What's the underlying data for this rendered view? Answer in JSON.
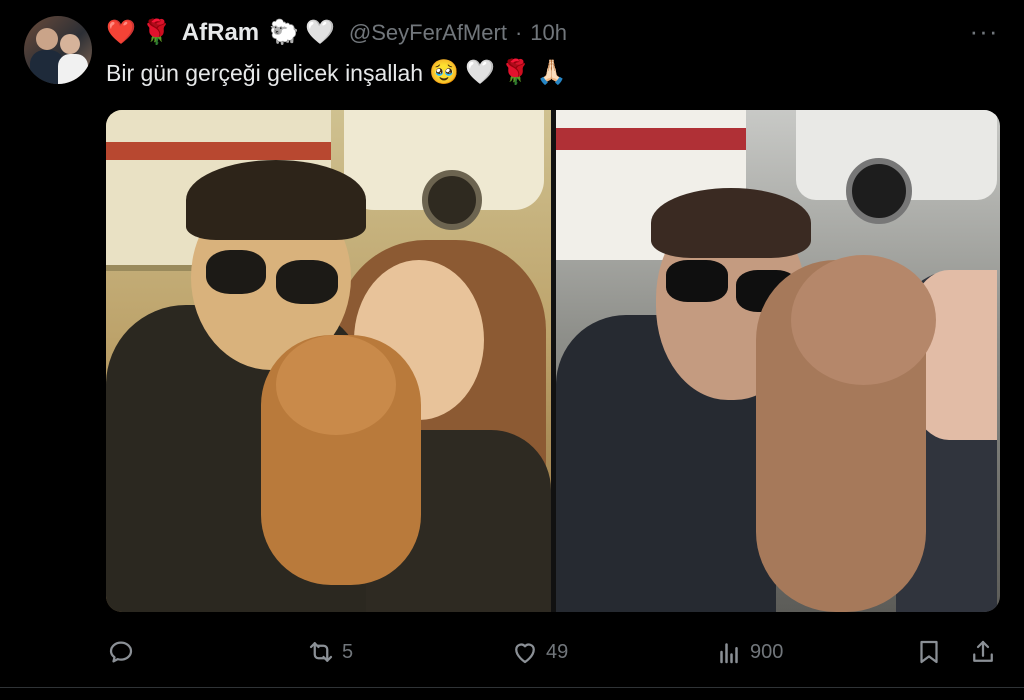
{
  "tweet": {
    "display_name": "AfRam",
    "handle": "@SeyFerAfMert",
    "separator": "·",
    "time": "10h",
    "name_emojis_before": [
      "❤️",
      "🌹"
    ],
    "name_emojis_after": [
      "🐑",
      "🤍"
    ],
    "text": "Bir gün gerçeği gelicek inşallah",
    "text_emojis": [
      "🥹",
      "🤍",
      "🌹",
      "🙏🏻"
    ],
    "more_label": "···"
  },
  "actions": {
    "reply_count": "",
    "retweet_count": "5",
    "like_count": "49",
    "views_count": "900"
  },
  "colors": {
    "background": "#000000",
    "text_primary": "#e7e9ea",
    "text_secondary": "#71767b",
    "heart_red": "#e0263c"
  },
  "icons": {
    "reply": "reply-icon",
    "retweet": "retweet-icon",
    "like": "heart-icon",
    "views": "views-icon",
    "bookmark": "bookmark-icon",
    "share": "share-icon",
    "more": "more-icon"
  }
}
